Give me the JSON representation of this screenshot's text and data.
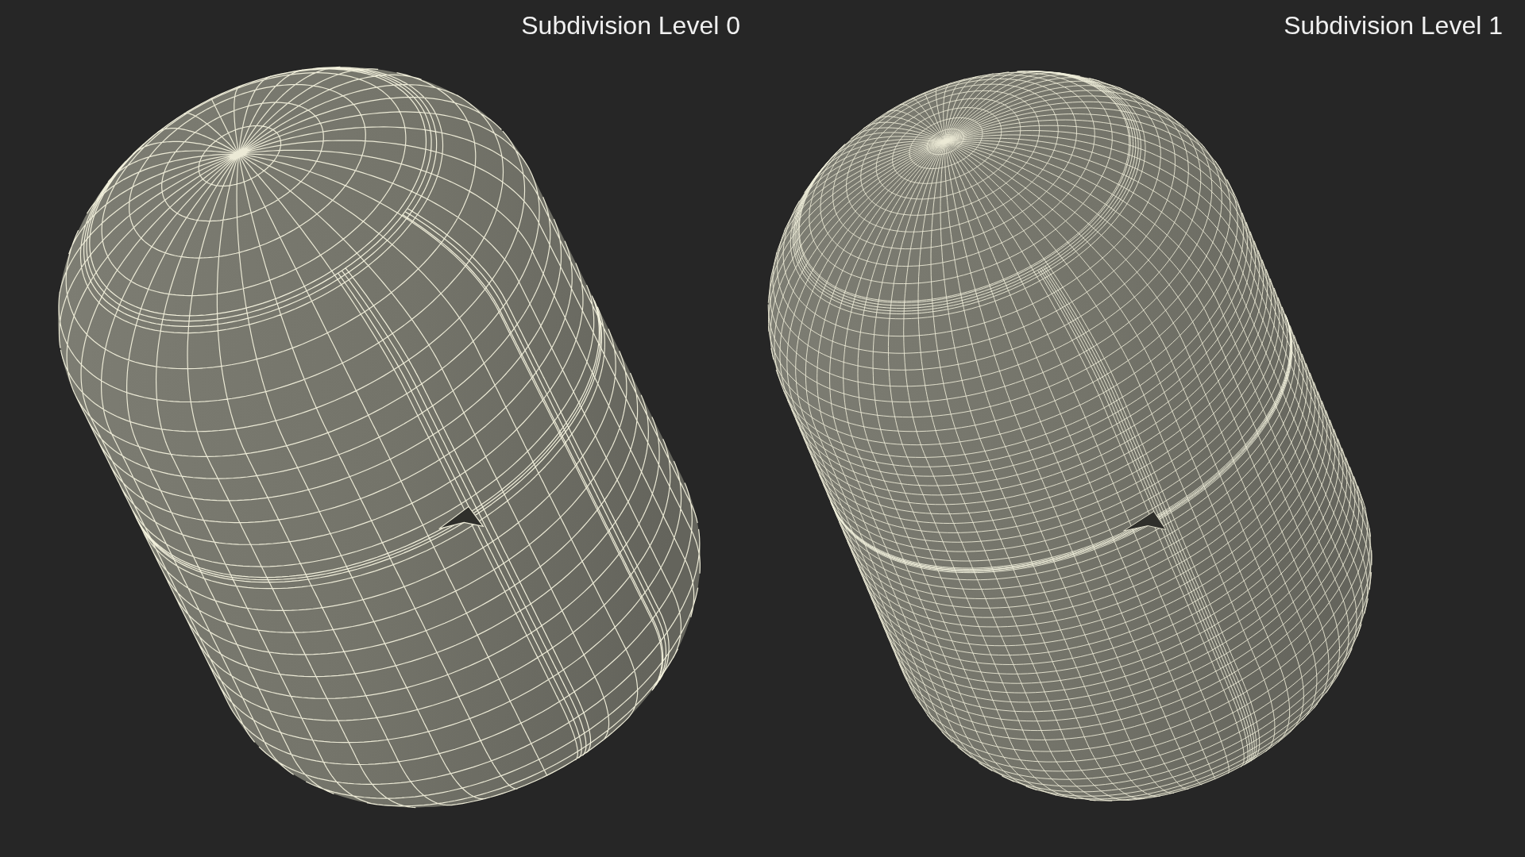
{
  "views": [
    {
      "label": "Subdivision Level 0",
      "kind": "coarse"
    },
    {
      "label": "Subdivision Level 1",
      "kind": "fine"
    }
  ]
}
